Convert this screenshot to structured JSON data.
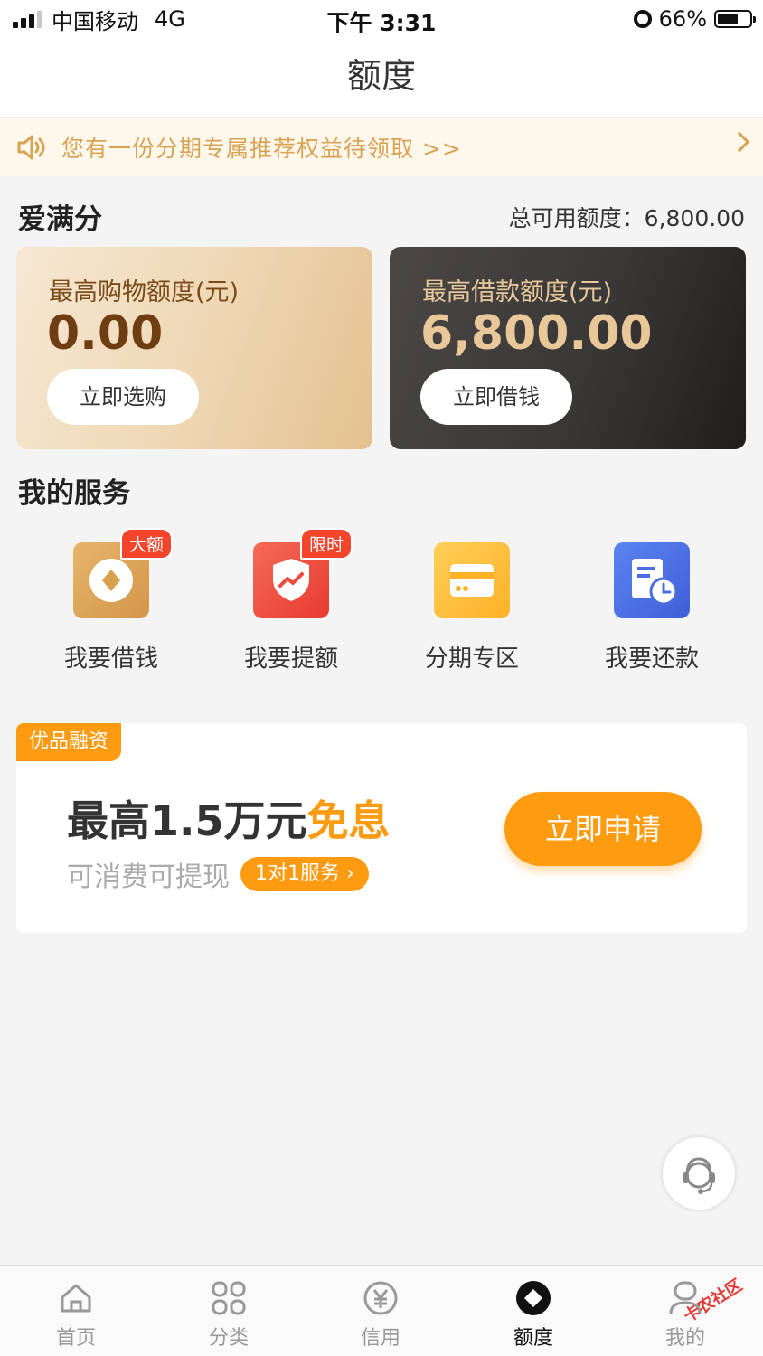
{
  "status_bar": {
    "carrier": "中国移动",
    "network": "4G",
    "time": "下午 3:31",
    "battery": "66%",
    "battery_level": 0.66
  },
  "nav": {
    "title": "额度"
  },
  "notice": {
    "text": "您有一份分期专属推荐权益待领取 >>"
  },
  "credit": {
    "title": "爱满分",
    "total_label": "总可用额度：6,800.00",
    "shopping": {
      "label": "最高购物额度(元)",
      "amount": "0.00",
      "button": "立即选购"
    },
    "loan": {
      "label": "最高借款额度(元)",
      "amount": "6,800.00",
      "button": "立即借钱"
    }
  },
  "services": {
    "title": "我的服务",
    "items": [
      {
        "label": "我要借钱",
        "badge": "大额",
        "icon": "coin-icon",
        "color": "#dca04e"
      },
      {
        "label": "我要提额",
        "badge": "限时",
        "icon": "shield-chart-icon",
        "color": "#ef4a3c"
      },
      {
        "label": "分期专区",
        "badge": "",
        "icon": "card-icon",
        "color": "#ffbb33"
      },
      {
        "label": "我要还款",
        "badge": "",
        "icon": "bill-clock-icon",
        "color": "#4a6ee0"
      }
    ]
  },
  "promo": {
    "tag": "优品融资",
    "main_prefix": "最高1.5万元",
    "main_highlight": "免息",
    "sub": "可消费可提现",
    "pill": "1对1服务 ›",
    "button": "立即申请"
  },
  "tabbar": {
    "items": [
      {
        "label": "首页",
        "icon": "home-icon",
        "active": false
      },
      {
        "label": "分类",
        "icon": "grid-icon",
        "active": false
      },
      {
        "label": "信用",
        "icon": "yen-icon",
        "active": false
      },
      {
        "label": "额度",
        "icon": "diamond-icon",
        "active": true
      },
      {
        "label": "我的",
        "icon": "user-icon",
        "active": false
      }
    ]
  },
  "watermark": "卡农社区",
  "colors": {
    "accent": "#ff9b11",
    "notice": "#d9a354",
    "badge": "#f2452c"
  }
}
